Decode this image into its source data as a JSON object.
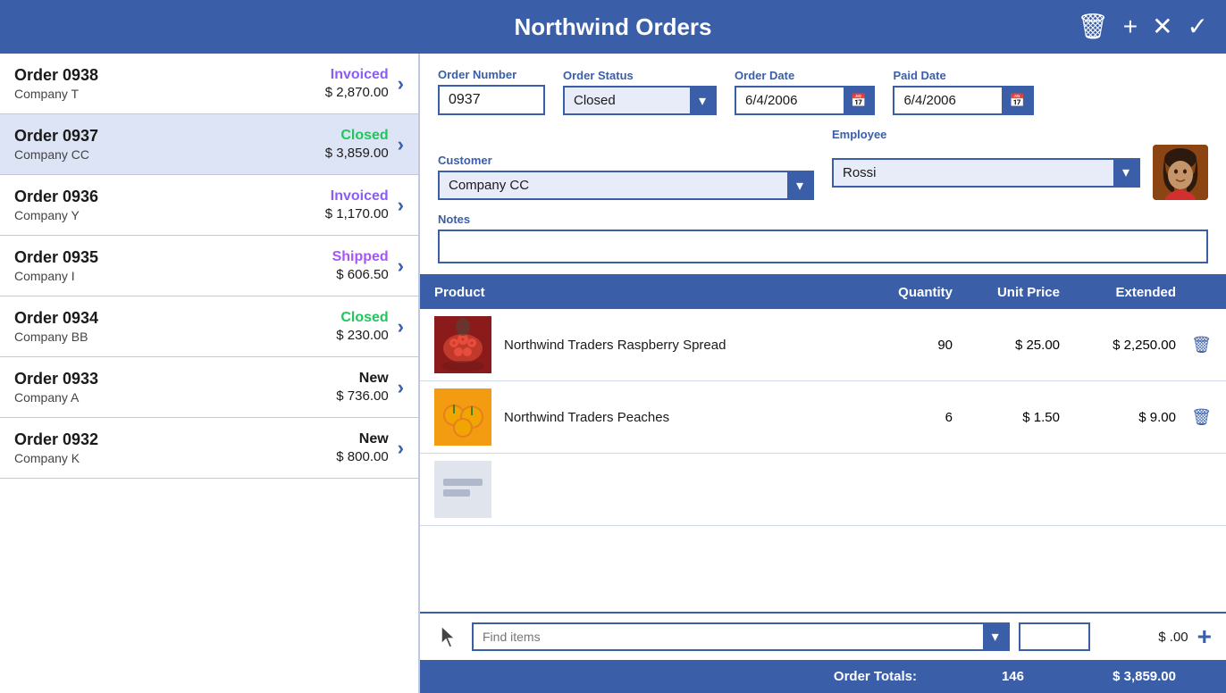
{
  "app": {
    "title": "Northwind Orders",
    "header_actions": {
      "delete_label": "🗑",
      "add_label": "+",
      "close_label": "✕",
      "confirm_label": "✓"
    }
  },
  "orders": [
    {
      "id": "0938",
      "company": "Company T",
      "status": "Invoiced",
      "amount": "$ 2,870.00",
      "status_class": "status-invoiced"
    },
    {
      "id": "0937",
      "company": "Company CC",
      "status": "Closed",
      "amount": "$ 3,859.00",
      "status_class": "status-closed",
      "selected": true
    },
    {
      "id": "0936",
      "company": "Company Y",
      "status": "Invoiced",
      "amount": "$ 1,170.00",
      "status_class": "status-invoiced"
    },
    {
      "id": "0935",
      "company": "Company I",
      "status": "Shipped",
      "amount": "$ 606.50",
      "status_class": "status-shipped"
    },
    {
      "id": "0934",
      "company": "Company BB",
      "status": "Closed",
      "amount": "$ 230.00",
      "status_class": "status-closed"
    },
    {
      "id": "0933",
      "company": "Company A",
      "status": "New",
      "amount": "$ 736.00",
      "status_class": "status-new"
    },
    {
      "id": "0932",
      "company": "Company K",
      "status": "New",
      "amount": "$ 800.00",
      "status_class": "status-new"
    }
  ],
  "detail": {
    "order_number_label": "Order Number",
    "order_number_value": "0937",
    "order_status_label": "Order Status",
    "order_status_value": "Closed",
    "order_date_label": "Order Date",
    "order_date_value": "6/4/2006",
    "paid_date_label": "Paid Date",
    "paid_date_value": "6/4/2006",
    "customer_label": "Customer",
    "customer_value": "Company CC",
    "employee_label": "Employee",
    "employee_value": "Rossi",
    "notes_label": "Notes",
    "notes_value": ""
  },
  "table": {
    "col_product": "Product",
    "col_quantity": "Quantity",
    "col_unit_price": "Unit Price",
    "col_extended": "Extended",
    "rows": [
      {
        "name": "Northwind Traders Raspberry Spread",
        "quantity": "90",
        "unit_price": "$ 25.00",
        "extended": "$ 2,250.00",
        "img_type": "raspberry"
      },
      {
        "name": "Northwind Traders Peaches",
        "quantity": "6",
        "unit_price": "$ 1.50",
        "extended": "$ 9.00",
        "img_type": "peaches"
      },
      {
        "name": "",
        "quantity": "",
        "unit_price": "",
        "extended": "",
        "img_type": "unknown"
      }
    ],
    "totals_label": "Order Totals:",
    "total_quantity": "146",
    "total_extended": "$ 3,859.00"
  },
  "add_item": {
    "find_placeholder": "Find items",
    "qty_value": "",
    "price_display": "$ .00",
    "add_label": "+"
  }
}
